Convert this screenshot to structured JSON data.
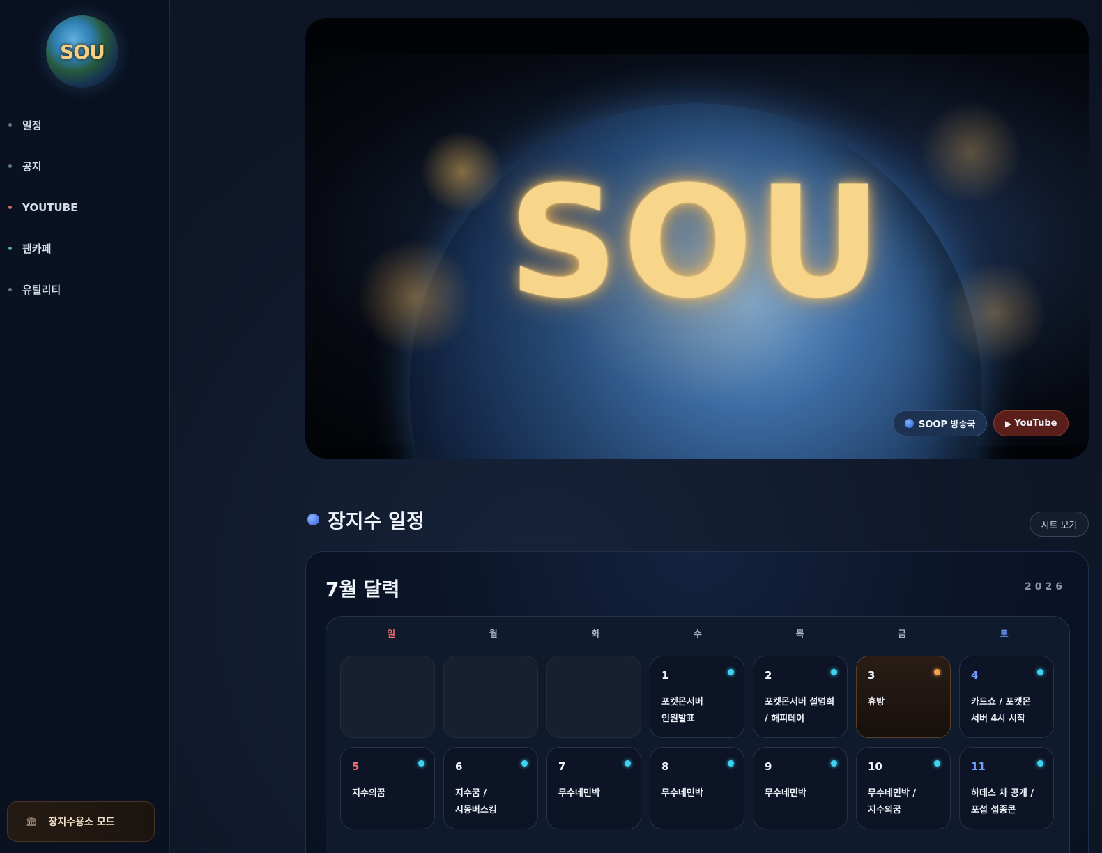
{
  "sidebar": {
    "logo_text": "SOU",
    "items": [
      {
        "label": "일정",
        "dot_color": "#5c7a9a"
      },
      {
        "label": "공지",
        "dot_color": "#5c7a9a"
      },
      {
        "label": "YOUTUBE",
        "dot_color": "#d46b5f"
      },
      {
        "label": "팬카페",
        "dot_color": "#4fb89a"
      },
      {
        "label": "유틸리티",
        "dot_color": "#5c7a9a"
      }
    ],
    "mode_button": {
      "icon": "bank-icon",
      "label": "장지수용소 모드"
    }
  },
  "hero": {
    "title": "SOU",
    "soop_chip": "SOOP 방송국",
    "youtube_chip": "YouTube"
  },
  "schedule": {
    "title": "장지수 일정",
    "sheet_button": "시트 보기",
    "calendar_title": "7월 달력",
    "year": "2026",
    "weekdays": [
      {
        "label": "일",
        "color": "#ee6b6b"
      },
      {
        "label": "월",
        "color": "#a9b3c3"
      },
      {
        "label": "화",
        "color": "#a9b3c3"
      },
      {
        "label": "수",
        "color": "#a9b3c3"
      },
      {
        "label": "목",
        "color": "#a9b3c3"
      },
      {
        "label": "금",
        "color": "#a9b3c3"
      },
      {
        "label": "토",
        "color": "#6f9dff"
      }
    ],
    "week1": [
      {
        "day": "",
        "event": "",
        "type": "empty"
      },
      {
        "day": "",
        "event": "",
        "type": "empty"
      },
      {
        "day": "",
        "event": "",
        "type": "empty"
      },
      {
        "day": "1",
        "event": "포켓몬서버\n인원발표",
        "type": "event"
      },
      {
        "day": "2",
        "event": "포켓몬서버 설명회\n/ 해피데이",
        "type": "event"
      },
      {
        "day": "3",
        "event": "휴방",
        "type": "rest"
      },
      {
        "day": "4",
        "event": "카드쇼 / 포켓몬\n서버 4시 시작",
        "type": "event"
      }
    ],
    "week2": [
      {
        "day": "5",
        "event": "지수의꿈",
        "type": "event"
      },
      {
        "day": "6",
        "event": "지수꿈 /\n시몽버스킹",
        "type": "event"
      },
      {
        "day": "7",
        "event": "무수네민박",
        "type": "event"
      },
      {
        "day": "8",
        "event": "무수네민박",
        "type": "event"
      },
      {
        "day": "9",
        "event": "무수네민박",
        "type": "event"
      },
      {
        "day": "10",
        "event": "무수네민박 /\n지수의꿈",
        "type": "event"
      },
      {
        "day": "11",
        "event": "하데스 차 공개 /\n포섭 섭종콘",
        "type": "event"
      }
    ],
    "sunday_color": "#ee6b6b",
    "saturday_color": "#6f9dff"
  }
}
